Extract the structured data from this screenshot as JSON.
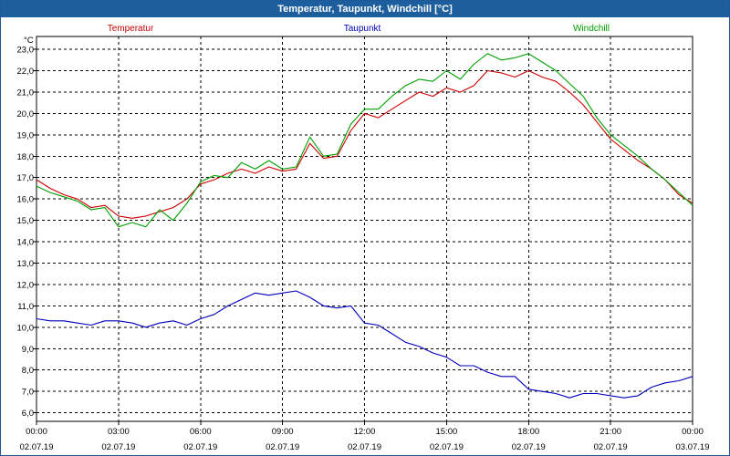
{
  "window": {
    "title": "Temperatur, Taupunkt, Windchill [°C]"
  },
  "chart_data": {
    "type": "line",
    "title": "Temperatur, Taupunkt, Windchill [°C]",
    "ylabel": "°C",
    "xlabel": "",
    "ylim": [
      5.6,
      23.6
    ],
    "xlim": [
      0,
      24
    ],
    "grid": true,
    "legend_position": "top",
    "x_ticks": [
      {
        "time": "00:00",
        "date": "02.07.19"
      },
      {
        "time": "03:00",
        "date": "02.07.19"
      },
      {
        "time": "06:00",
        "date": "02.07.19"
      },
      {
        "time": "09:00",
        "date": "02.07.19"
      },
      {
        "time": "12:00",
        "date": "02.07.19"
      },
      {
        "time": "15:00",
        "date": "02.07.19"
      },
      {
        "time": "18:00",
        "date": "02.07.19"
      },
      {
        "time": "21:00",
        "date": "02.07.19"
      },
      {
        "time": "00:00",
        "date": "03.07.19"
      }
    ],
    "y_ticks": [
      "6,0",
      "7,0",
      "8,0",
      "9,0",
      "10,0",
      "11,0",
      "12,0",
      "13,0",
      "14,0",
      "15,0",
      "16,0",
      "17,0",
      "18,0",
      "19,0",
      "20,0",
      "21,0",
      "22,0",
      "23,0"
    ],
    "series": [
      {
        "name": "Temperatur",
        "color": "#cc0000",
        "points": [
          [
            0,
            16.9
          ],
          [
            0.5,
            16.5
          ],
          [
            1,
            16.2
          ],
          [
            1.5,
            16.0
          ],
          [
            2,
            15.6
          ],
          [
            2.5,
            15.7
          ],
          [
            3,
            15.2
          ],
          [
            3.5,
            15.1
          ],
          [
            4,
            15.2
          ],
          [
            4.5,
            15.4
          ],
          [
            5,
            15.6
          ],
          [
            5.5,
            16.0
          ],
          [
            6,
            16.7
          ],
          [
            6.5,
            16.9
          ],
          [
            7,
            17.2
          ],
          [
            7.5,
            17.4
          ],
          [
            8,
            17.2
          ],
          [
            8.5,
            17.5
          ],
          [
            9,
            17.3
          ],
          [
            9.5,
            17.4
          ],
          [
            10,
            18.6
          ],
          [
            10.5,
            17.9
          ],
          [
            11,
            18.0
          ],
          [
            11.5,
            19.2
          ],
          [
            12,
            20.0
          ],
          [
            12.5,
            19.8
          ],
          [
            13,
            20.2
          ],
          [
            13.5,
            20.6
          ],
          [
            14,
            21.0
          ],
          [
            14.5,
            20.8
          ],
          [
            15,
            21.2
          ],
          [
            15.5,
            21.0
          ],
          [
            16,
            21.3
          ],
          [
            16.5,
            22.0
          ],
          [
            17,
            21.9
          ],
          [
            17.5,
            21.7
          ],
          [
            18,
            22.0
          ],
          [
            18.5,
            21.7
          ],
          [
            19,
            21.5
          ],
          [
            19.5,
            21.0
          ],
          [
            20,
            20.4
          ],
          [
            20.5,
            19.6
          ],
          [
            21,
            18.8
          ],
          [
            21.5,
            18.3
          ],
          [
            22,
            17.8
          ],
          [
            22.5,
            17.4
          ],
          [
            23,
            16.9
          ],
          [
            23.5,
            16.2
          ],
          [
            24,
            15.8
          ]
        ]
      },
      {
        "name": "Taupunkt",
        "color": "#0000bb",
        "points": [
          [
            0,
            10.4
          ],
          [
            0.5,
            10.3
          ],
          [
            1,
            10.3
          ],
          [
            1.5,
            10.2
          ],
          [
            2,
            10.1
          ],
          [
            2.5,
            10.3
          ],
          [
            3,
            10.3
          ],
          [
            3.5,
            10.2
          ],
          [
            4,
            10.0
          ],
          [
            4.5,
            10.2
          ],
          [
            5,
            10.3
          ],
          [
            5.5,
            10.1
          ],
          [
            6,
            10.4
          ],
          [
            6.5,
            10.6
          ],
          [
            7,
            11.0
          ],
          [
            7.5,
            11.3
          ],
          [
            8,
            11.6
          ],
          [
            8.5,
            11.5
          ],
          [
            9,
            11.6
          ],
          [
            9.5,
            11.7
          ],
          [
            10,
            11.4
          ],
          [
            10.5,
            11.0
          ],
          [
            11,
            10.9
          ],
          [
            11.5,
            11.0
          ],
          [
            12,
            10.2
          ],
          [
            12.5,
            10.1
          ],
          [
            13,
            9.7
          ],
          [
            13.5,
            9.3
          ],
          [
            14,
            9.1
          ],
          [
            14.5,
            8.8
          ],
          [
            15,
            8.6
          ],
          [
            15.5,
            8.2
          ],
          [
            16,
            8.2
          ],
          [
            16.5,
            7.9
          ],
          [
            17,
            7.7
          ],
          [
            17.5,
            7.7
          ],
          [
            18,
            7.1
          ],
          [
            18.5,
            7.0
          ],
          [
            19,
            6.9
          ],
          [
            19.5,
            6.7
          ],
          [
            20,
            6.9
          ],
          [
            20.5,
            6.9
          ],
          [
            21,
            6.8
          ],
          [
            21.5,
            6.7
          ],
          [
            22,
            6.8
          ],
          [
            22.5,
            7.2
          ],
          [
            23,
            7.4
          ],
          [
            23.5,
            7.5
          ],
          [
            24,
            7.7
          ]
        ]
      },
      {
        "name": "Windchill",
        "color": "#00a000",
        "points": [
          [
            0,
            16.6
          ],
          [
            0.5,
            16.3
          ],
          [
            1,
            16.1
          ],
          [
            1.5,
            15.9
          ],
          [
            2,
            15.5
          ],
          [
            2.5,
            15.6
          ],
          [
            3,
            14.7
          ],
          [
            3.5,
            14.9
          ],
          [
            4,
            14.7
          ],
          [
            4.5,
            15.5
          ],
          [
            5,
            15.0
          ],
          [
            5.5,
            15.8
          ],
          [
            6,
            16.8
          ],
          [
            6.5,
            17.1
          ],
          [
            7,
            17.0
          ],
          [
            7.5,
            17.7
          ],
          [
            8,
            17.4
          ],
          [
            8.5,
            17.8
          ],
          [
            9,
            17.4
          ],
          [
            9.5,
            17.5
          ],
          [
            10,
            18.9
          ],
          [
            10.5,
            18.0
          ],
          [
            11,
            18.1
          ],
          [
            11.5,
            19.5
          ],
          [
            12,
            20.2
          ],
          [
            12.5,
            20.2
          ],
          [
            13,
            20.8
          ],
          [
            13.5,
            21.3
          ],
          [
            14,
            21.6
          ],
          [
            14.5,
            21.5
          ],
          [
            15,
            22.0
          ],
          [
            15.5,
            21.6
          ],
          [
            16,
            22.3
          ],
          [
            16.5,
            22.8
          ],
          [
            17,
            22.5
          ],
          [
            17.5,
            22.6
          ],
          [
            18,
            22.8
          ],
          [
            18.5,
            22.4
          ],
          [
            19,
            22.0
          ],
          [
            19.5,
            21.4
          ],
          [
            20,
            20.8
          ],
          [
            20.5,
            19.8
          ],
          [
            21,
            19.0
          ],
          [
            21.5,
            18.5
          ],
          [
            22,
            18.0
          ],
          [
            22.5,
            17.4
          ],
          [
            23,
            16.9
          ],
          [
            23.5,
            16.3
          ],
          [
            24,
            15.7
          ]
        ]
      }
    ]
  }
}
